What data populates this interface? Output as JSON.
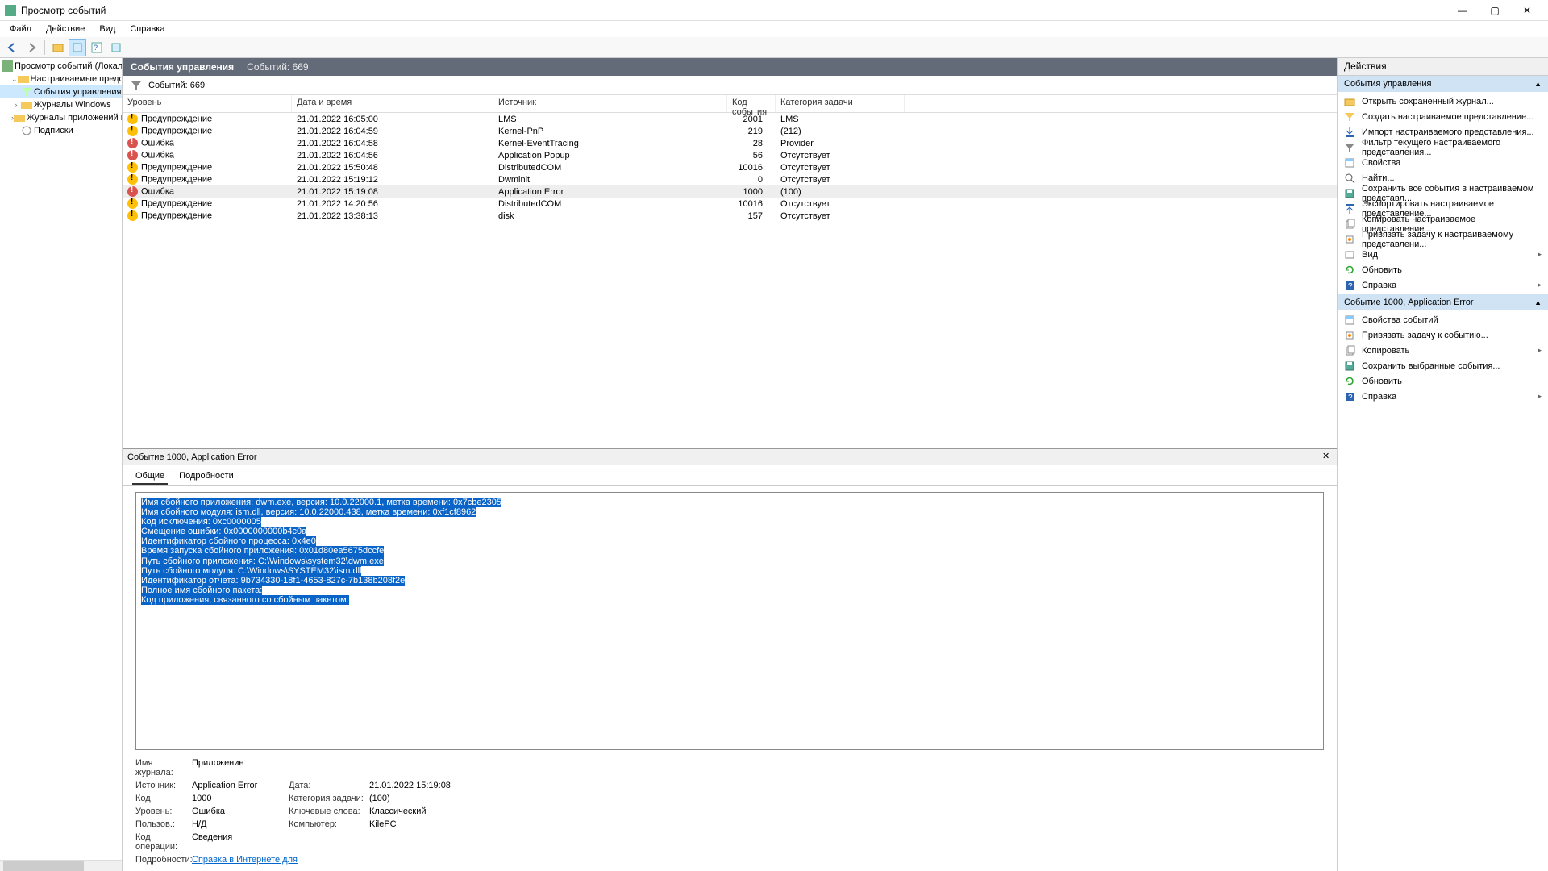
{
  "window": {
    "title": "Просмотр событий"
  },
  "menu": [
    "Файл",
    "Действие",
    "Вид",
    "Справка"
  ],
  "tree": {
    "root": "Просмотр событий (Локальны",
    "items": [
      {
        "label": "Настраиваемые представле",
        "expanded": true,
        "children": [
          {
            "label": "События управления",
            "selected": true
          }
        ]
      },
      {
        "label": "Журналы Windows",
        "expanded": false
      },
      {
        "label": "Журналы приложений и сл",
        "expanded": false
      },
      {
        "label": "Подписки",
        "expanded": false
      }
    ]
  },
  "center": {
    "title": "События управления",
    "count_label": "Событий: 669",
    "columns": [
      "Уровень",
      "Дата и время",
      "Источник",
      "Код события",
      "Категория задачи"
    ],
    "rows": [
      {
        "level": "Предупреждение",
        "level_type": "warn",
        "date": "21.01.2022 16:05:00",
        "source": "LMS",
        "code": "2001",
        "task": "LMS"
      },
      {
        "level": "Предупреждение",
        "level_type": "warn",
        "date": "21.01.2022 16:04:59",
        "source": "Kernel-PnP",
        "code": "219",
        "task": "(212)"
      },
      {
        "level": "Ошибка",
        "level_type": "err",
        "date": "21.01.2022 16:04:58",
        "source": "Kernel-EventTracing",
        "code": "28",
        "task": "Provider"
      },
      {
        "level": "Ошибка",
        "level_type": "err",
        "date": "21.01.2022 16:04:56",
        "source": "Application Popup",
        "code": "56",
        "task": "Отсутствует"
      },
      {
        "level": "Предупреждение",
        "level_type": "warn",
        "date": "21.01.2022 15:50:48",
        "source": "DistributedCOM",
        "code": "10016",
        "task": "Отсутствует"
      },
      {
        "level": "Предупреждение",
        "level_type": "warn",
        "date": "21.01.2022 15:19:12",
        "source": "Dwminit",
        "code": "0",
        "task": "Отсутствует"
      },
      {
        "level": "Ошибка",
        "level_type": "err",
        "date": "21.01.2022 15:19:08",
        "source": "Application Error",
        "code": "1000",
        "task": "(100)",
        "selected": true
      },
      {
        "level": "Предупреждение",
        "level_type": "warn",
        "date": "21.01.2022 14:20:56",
        "source": "DistributedCOM",
        "code": "10016",
        "task": "Отсутствует"
      },
      {
        "level": "Предупреждение",
        "level_type": "warn",
        "date": "21.01.2022 13:38:13",
        "source": "disk",
        "code": "157",
        "task": "Отсутствует"
      }
    ]
  },
  "detail": {
    "title": "Событие 1000, Application Error",
    "tabs": [
      "Общие",
      "Подробности"
    ],
    "description_lines": [
      "Имя сбойного приложения: dwm.exe, версия: 10.0.22000.1, метка времени: 0x7cbe2305",
      "Имя сбойного модуля: ism.dll, версия: 10.0.22000.438, метка времени: 0xf1cf8962",
      "Код исключения: 0xc0000005",
      "Смещение ошибки: 0x0000000000b4c0a",
      "Идентификатор сбойного процесса: 0x4e0",
      "Время запуска сбойного приложения: 0x01d80ea5675dccfe",
      "Путь сбойного приложения: C:\\Windows\\system32\\dwm.exe",
      "Путь сбойного модуля: C:\\Windows\\SYSTEM32\\ism.dll",
      "Идентификатор отчета: 9b734330-18f1-4653-827c-7b138b208f2e",
      "Полное имя сбойного пакета:",
      "Код приложения, связанного со сбойным пакетом:"
    ],
    "meta": {
      "log_label": "Имя журнала:",
      "log": "Приложение",
      "source_label": "Источник:",
      "source": "Application Error",
      "code_label": "Код",
      "code": "1000",
      "level_label": "Уровень:",
      "level": "Ошибка",
      "user_label": "Пользов.:",
      "user": "Н/Д",
      "opcode_label": "Код операции:",
      "opcode": "Сведения",
      "details_label": "Подробности:",
      "details_link": "Справка в Интернете для",
      "date_label": "Дата:",
      "date": "21.01.2022 15:19:08",
      "task_label": "Категория задачи:",
      "task": "(100)",
      "keywords_label": "Ключевые слова:",
      "keywords": "Классический",
      "computer_label": "Компьютер:",
      "computer": "KilePC"
    }
  },
  "actions": {
    "title": "Действия",
    "section1": {
      "title": "События управления",
      "items": [
        {
          "icon": "folder",
          "label": "Открыть сохраненный журнал..."
        },
        {
          "icon": "filter-new",
          "label": "Создать настраиваемое представление..."
        },
        {
          "icon": "import",
          "label": "Импорт настраиваемого представления..."
        },
        {
          "icon": "filter",
          "label": "Фильтр текущего настраиваемого представления..."
        },
        {
          "icon": "props",
          "label": "Свойства"
        },
        {
          "icon": "find",
          "label": "Найти..."
        },
        {
          "icon": "save",
          "label": "Сохранить все события в настраиваемом представл..."
        },
        {
          "icon": "export",
          "label": "Экспортировать настраиваемое представление..."
        },
        {
          "icon": "copy",
          "label": "Копировать настраиваемое представление..."
        },
        {
          "icon": "attach",
          "label": "Привязать задачу к настраиваемому представлени..."
        },
        {
          "icon": "view",
          "label": "Вид",
          "sub": "▸"
        },
        {
          "icon": "refresh",
          "label": "Обновить"
        },
        {
          "icon": "help",
          "label": "Справка",
          "sub": "▸"
        }
      ]
    },
    "section2": {
      "title": "Событие 1000, Application Error",
      "items": [
        {
          "icon": "props",
          "label": "Свойства событий"
        },
        {
          "icon": "attach",
          "label": "Привязать задачу к событию..."
        },
        {
          "icon": "copy",
          "label": "Копировать",
          "sub": "▸"
        },
        {
          "icon": "save",
          "label": "Сохранить выбранные события..."
        },
        {
          "icon": "refresh",
          "label": "Обновить"
        },
        {
          "icon": "help",
          "label": "Справка",
          "sub": "▸"
        }
      ]
    }
  }
}
